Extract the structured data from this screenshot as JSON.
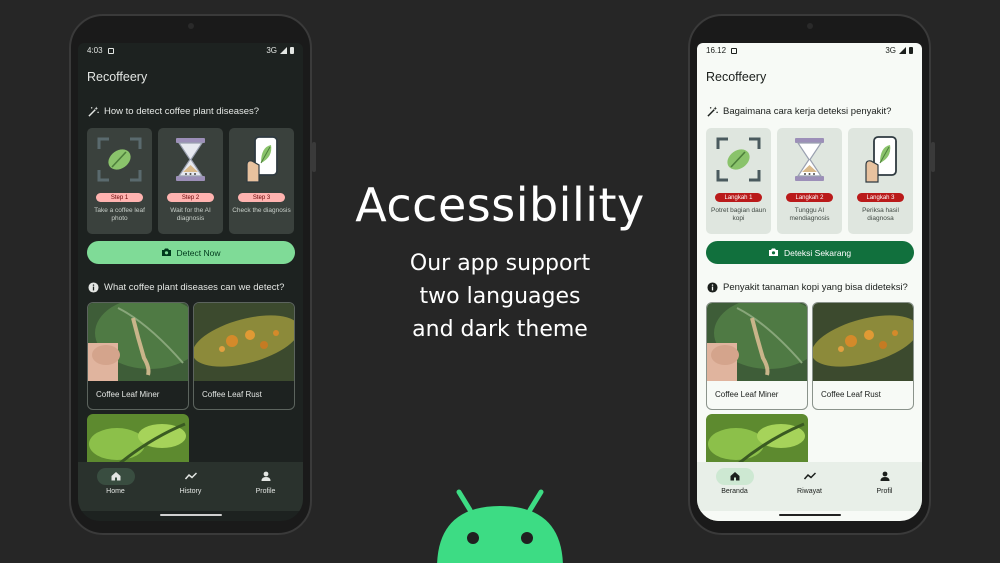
{
  "headline": "Accessibility",
  "subtitle_lines": [
    "Our app support",
    "two languages",
    "and dark theme"
  ],
  "phones": [
    {
      "theme": "dark",
      "status_time": "4:03",
      "network": "3G",
      "app_title": "Recoffeery",
      "detect_question": "How to detect coffee plant diseases?",
      "steps": [
        {
          "badge": "Step 1",
          "caption": "Take a coffee leaf photo",
          "icon": "scan-leaf-icon"
        },
        {
          "badge": "Step 2",
          "caption": "Wait for the AI diagnosis",
          "icon": "hourglass-icon"
        },
        {
          "badge": "Step 3",
          "caption": "Check the diagnosis",
          "icon": "phone-hand-icon"
        }
      ],
      "detect_button": "Detect Now",
      "diseases_question": "What coffee plant diseases can we detect?",
      "cards": [
        "Coffee Leaf Miner",
        "Coffee Leaf Rust"
      ],
      "nav": [
        "Home",
        "History",
        "Profile"
      ]
    },
    {
      "theme": "light",
      "status_time": "16.12",
      "network": "3G",
      "app_title": "Recoffeery",
      "detect_question": "Bagaimana cara kerja deteksi penyakit?",
      "steps": [
        {
          "badge": "Langkah 1",
          "caption": "Potret bagian daun kopi",
          "icon": "scan-leaf-icon"
        },
        {
          "badge": "Langkah 2",
          "caption": "Tunggu AI mendiagnosis",
          "icon": "hourglass-icon"
        },
        {
          "badge": "Langkah 3",
          "caption": "Periksa hasil diagnosa",
          "icon": "phone-hand-icon"
        }
      ],
      "detect_button": "Deteksi Sekarang",
      "diseases_question": "Penyakit tanaman kopi yang bisa dideteksi?",
      "cards": [
        "Coffee Leaf Miner",
        "Coffee Leaf Rust"
      ],
      "nav": [
        "Beranda",
        "Riwayat",
        "Profil"
      ]
    }
  ],
  "colors": {
    "background": "#262626",
    "dark_primary": "#7fdb97",
    "light_primary": "#11703d",
    "android_green": "#3ddc84"
  }
}
